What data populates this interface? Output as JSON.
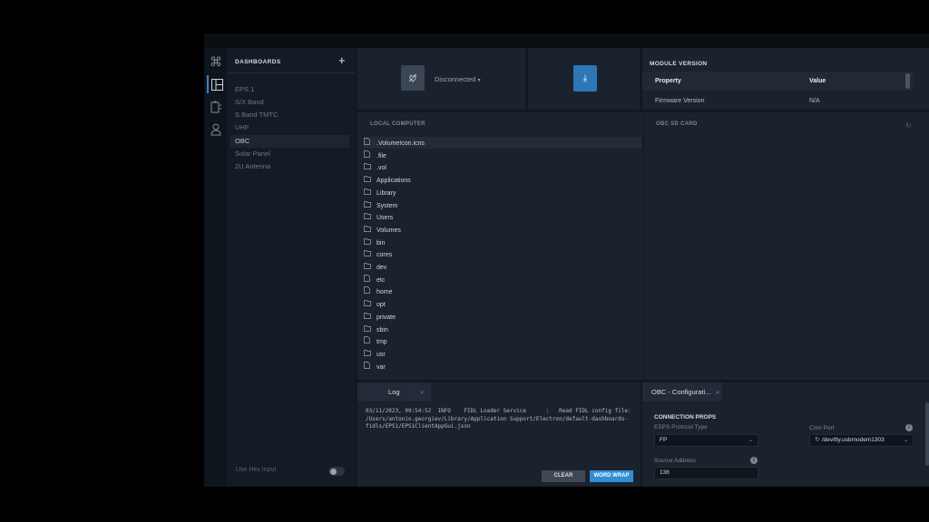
{
  "icons": {
    "rail": [
      "command-icon",
      "dashboard-icon",
      "battery-icon",
      "user-icon"
    ]
  },
  "sidebar": {
    "title": "DASHBOARDS",
    "add_label": "+",
    "items": [
      "EPS 1",
      "S/X Band",
      "S Band TMTC",
      "UHF",
      "OBC",
      "Solar Panel",
      "2U Antenna"
    ],
    "selected": "OBC",
    "hex_input_label": "Use Hex Input",
    "hex_input_enabled": false
  },
  "connection": {
    "status": "Disconnected"
  },
  "module_version": {
    "title": "MODULE VERSION",
    "col_property": "Property",
    "col_value": "Value",
    "rows": [
      {
        "property": "Firmware Version",
        "value": "N/A"
      }
    ]
  },
  "local_computer": {
    "title": "LOCAL COMPUTER",
    "files": [
      {
        "name": ".VolumeIcon.icns",
        "type": "file"
      },
      {
        "name": ".file",
        "type": "file"
      },
      {
        "name": ".vol",
        "type": "folder"
      },
      {
        "name": "Applications",
        "type": "folder"
      },
      {
        "name": "Library",
        "type": "folder"
      },
      {
        "name": "System",
        "type": "folder"
      },
      {
        "name": "Users",
        "type": "folder"
      },
      {
        "name": "Volumes",
        "type": "folder"
      },
      {
        "name": "bin",
        "type": "folder"
      },
      {
        "name": "cores",
        "type": "folder"
      },
      {
        "name": "dev",
        "type": "folder"
      },
      {
        "name": "etc",
        "type": "file"
      },
      {
        "name": "home",
        "type": "file"
      },
      {
        "name": "opt",
        "type": "folder"
      },
      {
        "name": "private",
        "type": "folder"
      },
      {
        "name": "sbin",
        "type": "folder"
      },
      {
        "name": "tmp",
        "type": "file"
      },
      {
        "name": "usr",
        "type": "folder"
      },
      {
        "name": "var",
        "type": "file"
      }
    ]
  },
  "sd_card": {
    "title": "OBC SD CARD"
  },
  "log": {
    "tab_label": "Log",
    "text": "03/11/2023, 09:54:52  INFO    FIDL Loader Service      :   Read FIDL config file: /Users/antonio.georgiev/Library/Application Support/Electron/default-dashboards-fidls/EPS1/EPS1ClientAppGui.json",
    "clear_label": "CLEAR",
    "wrap_label": "WORD WRAP"
  },
  "config": {
    "tab_label": "OBC - Configurati...",
    "section_title": "CONNECTION PROPS",
    "protocol_label": "ESPS Protocol Type",
    "protocol_value": "FP",
    "com_port_label": "Com Port",
    "com_port_value": "/dev/tty.usbmodem1303",
    "source_address_label": "Source Address",
    "source_address_value": "136"
  }
}
